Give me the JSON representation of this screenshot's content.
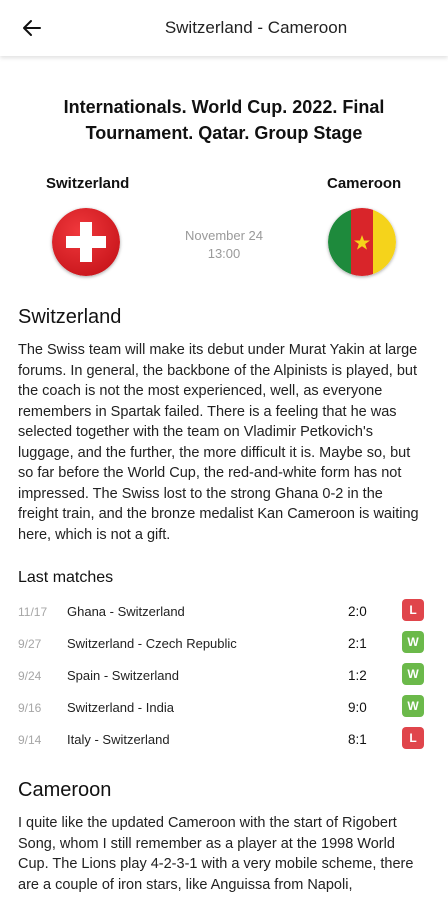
{
  "header": {
    "back_icon": "arrow-left-icon",
    "title": "Switzerland - Cameroon"
  },
  "tournament": "Internationals. World Cup. 2022. Final Tournament. Qatar. Group Stage",
  "match": {
    "home": "Switzerland",
    "away": "Cameroon",
    "date": "November 24",
    "time": "13:00"
  },
  "switzerland": {
    "title": "Switzerland",
    "text": "The Swiss team will make its debut under Murat Yakin at large forums. In general, the backbone of the Alpinists is played, but the coach is not the most experienced, well, as everyone remembers in Spartak failed. There is a feeling that he was selected together with the team on Vladimir Petkovich's luggage, and the further, the more difficult it is. Maybe so, but so far before the World Cup, the red-and-white form has not impressed. The Swiss lost to the strong Ghana 0-2 in the freight train, and the bronze medalist Kan Cameroon is waiting here, which is not a gift."
  },
  "last_matches": {
    "title": "Last matches",
    "rows": [
      {
        "date": "11/17",
        "teams": "Ghana - Switzerland",
        "score": "2:0",
        "result": "L"
      },
      {
        "date": "9/27",
        "teams": "Switzerland - Czech Republic",
        "score": "2:1",
        "result": "W"
      },
      {
        "date": "9/24",
        "teams": "Spain - Switzerland",
        "score": "1:2",
        "result": "W"
      },
      {
        "date": "9/16",
        "teams": "Switzerland - India",
        "score": "9:0",
        "result": "W"
      },
      {
        "date": "9/14",
        "teams": "Italy - Switzerland",
        "score": "8:1",
        "result": "L"
      }
    ]
  },
  "cameroon": {
    "title": "Cameroon",
    "text": "I quite like the updated Cameroon with the start of Rigobert Song, whom I still remember as a player at the 1998 World Cup. The Lions play 4-2-3-1 with a very mobile scheme, there are a couple of iron stars, like Anguissa from Napoli,"
  },
  "colors": {
    "loss": "#e0454b",
    "win": "#6bb94a"
  }
}
